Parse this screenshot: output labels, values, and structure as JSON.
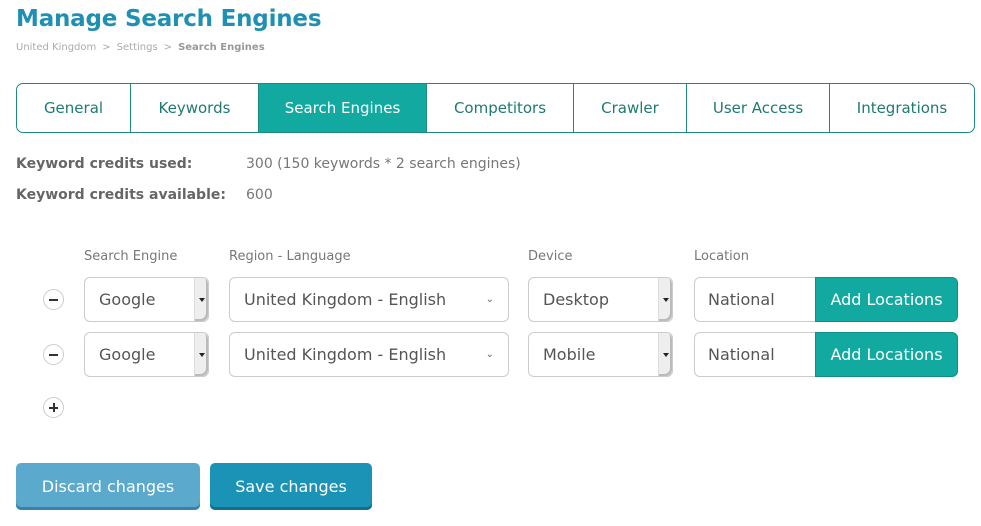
{
  "header": {
    "title": "Manage Search Engines",
    "breadcrumb": [
      {
        "label": "United Kingdom"
      },
      {
        "label": "Settings"
      },
      {
        "label": "Search Engines"
      }
    ],
    "breadcrumb_separator": ">"
  },
  "tabs": [
    {
      "label": "General",
      "active": false
    },
    {
      "label": "Keywords",
      "active": false
    },
    {
      "label": "Search Engines",
      "active": true
    },
    {
      "label": "Competitors",
      "active": false
    },
    {
      "label": "Crawler",
      "active": false
    },
    {
      "label": "User Access",
      "active": false
    },
    {
      "label": "Integrations",
      "active": false
    }
  ],
  "credits": {
    "used_label": "Keyword credits used:",
    "used_value": "300 (150 keywords * 2 search engines)",
    "available_label": "Keyword credits available:",
    "available_value": "600"
  },
  "columns": {
    "search_engine": "Search Engine",
    "region_language": "Region - Language",
    "device": "Device",
    "location": "Location"
  },
  "rows": [
    {
      "search_engine": "Google",
      "region_language": "United Kingdom - English",
      "device": "Desktop",
      "location": "National",
      "add_locations_label": "Add Locations"
    },
    {
      "search_engine": "Google",
      "region_language": "United Kingdom - English",
      "device": "Mobile",
      "location": "National",
      "add_locations_label": "Add Locations"
    }
  ],
  "icons": {
    "remove_row": "minus-circle-icon",
    "add_row": "plus-circle-icon",
    "select_arrow": "caret-down-icon",
    "region_chevron": "chevron-down-icon"
  },
  "actions": {
    "discard_label": "Discard changes",
    "save_label": "Save changes"
  },
  "colors": {
    "title": "#1f8fb3",
    "active_tab": "#12aaa0",
    "tab_border": "#1e8a80",
    "discard_button": "#5ba9cc",
    "save_button": "#1a93b7"
  }
}
